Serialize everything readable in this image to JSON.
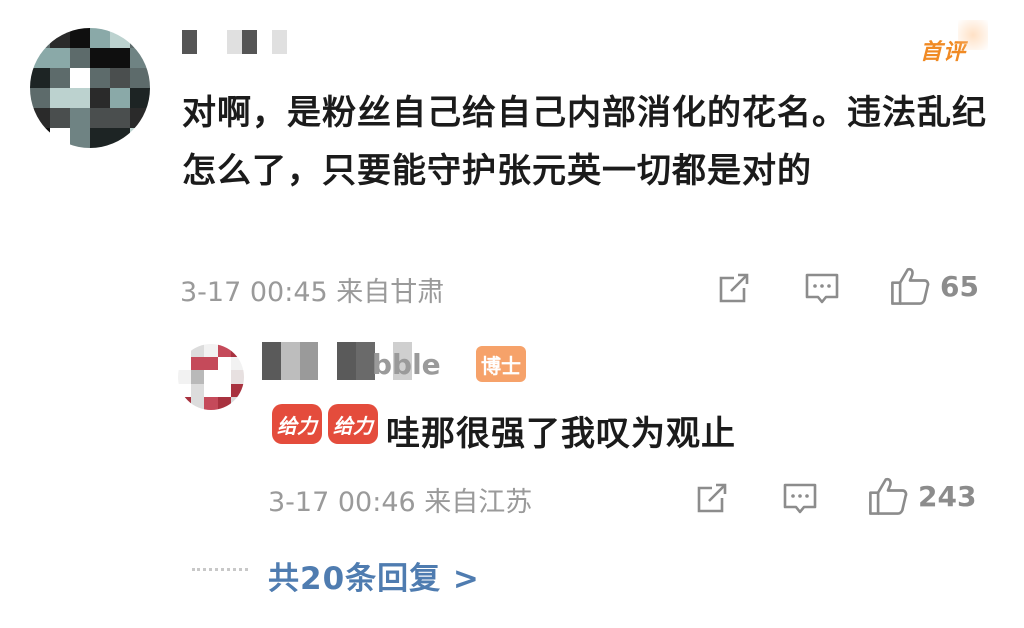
{
  "comment": {
    "badge": "首评",
    "text": "对啊，是粉丝自己给自己内部消化的花名。违法乱纪怎么了，只要能守护张元英一切都是对的",
    "meta": "3-17 00:45 来自甘肃",
    "like_count": "65",
    "icons": [
      "share-icon",
      "comment-icon",
      "like-icon"
    ]
  },
  "reply": {
    "name_tail": "bble",
    "level_badge": "博士",
    "emoji_label": "给力",
    "text": "哇那很强了我叹为观止",
    "meta": "3-17 00:46 来自江苏",
    "like_count": "243",
    "icons": [
      "share-icon",
      "comment-icon",
      "like-icon"
    ]
  },
  "more_replies": "共20条回复 >",
  "colors": {
    "accent_orange": "#f08a24",
    "link_blue": "#4f7cb0",
    "meta_gray": "#9a9a9a",
    "emoji_red": "#e44c3c"
  }
}
